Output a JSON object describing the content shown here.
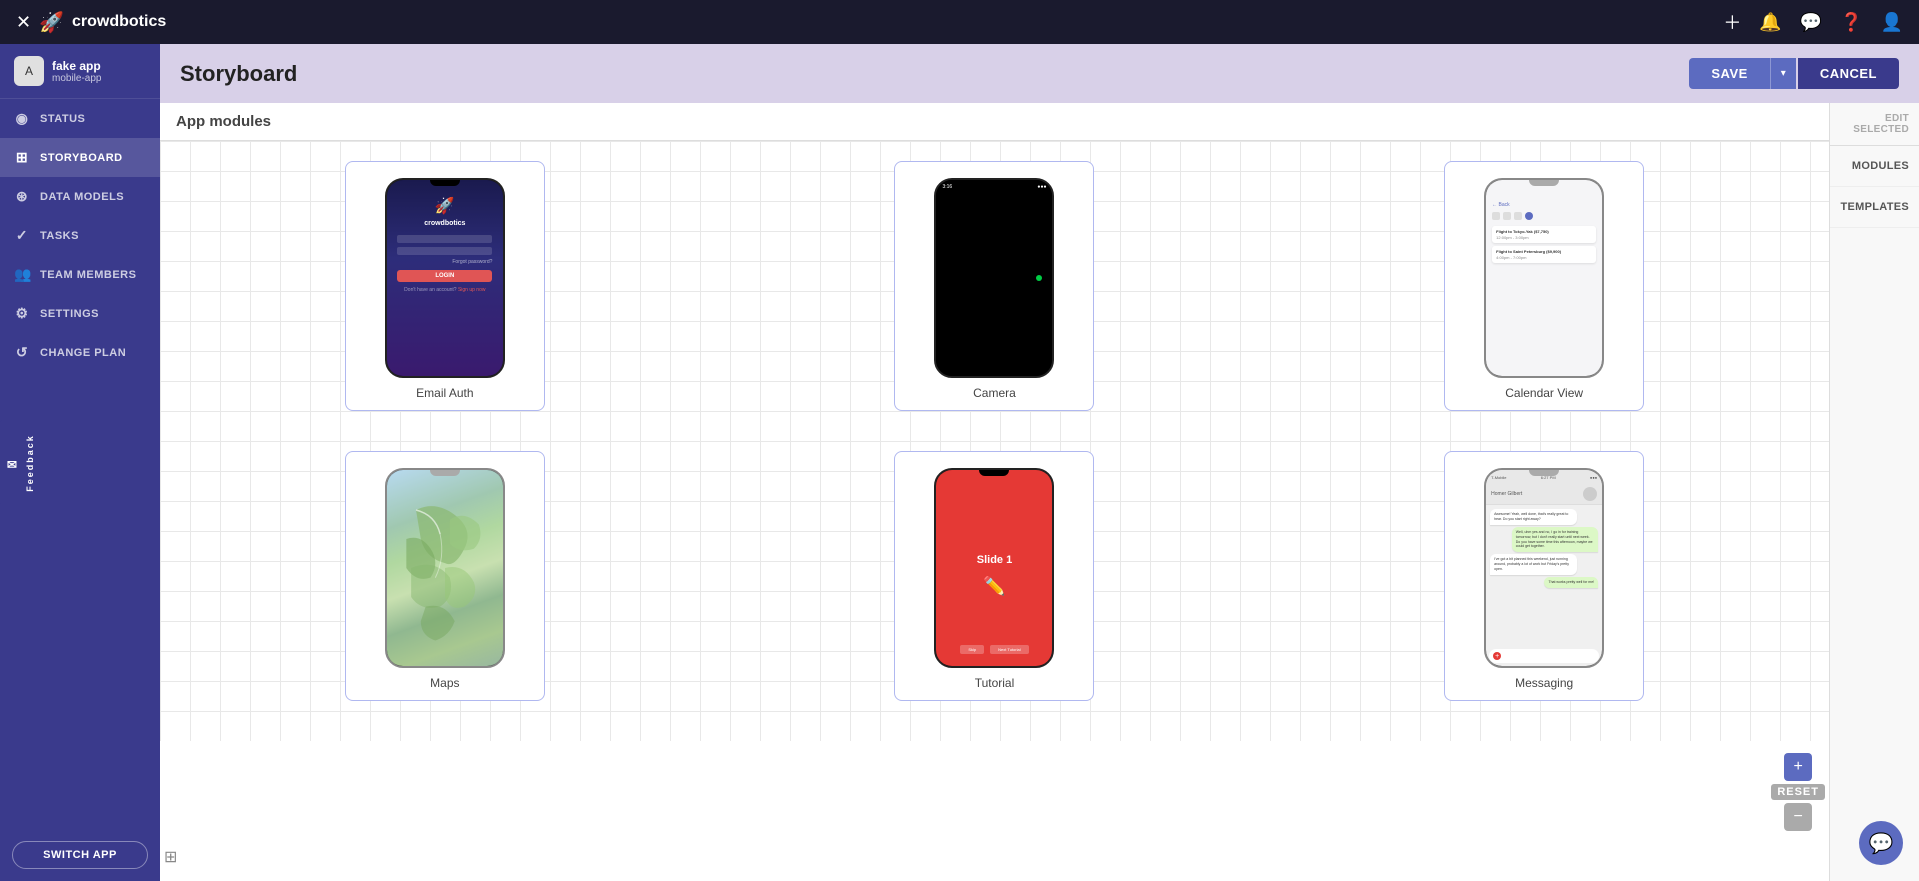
{
  "topnav": {
    "logo_text": "crowdbotics",
    "close_label": "✕"
  },
  "header": {
    "title": "Storyboard",
    "save_label": "SAVE",
    "cancel_label": "CANCEL"
  },
  "sidebar": {
    "app_name": "fake app",
    "app_sub": "mobile-app",
    "items": [
      {
        "id": "status",
        "label": "STATUS",
        "icon": "◉"
      },
      {
        "id": "storyboard",
        "label": "STORYBOARD",
        "icon": "⊞",
        "active": true
      },
      {
        "id": "data-models",
        "label": "DATA MODELS",
        "icon": "⊛"
      },
      {
        "id": "tasks",
        "label": "TASKS",
        "icon": "✓"
      },
      {
        "id": "team-members",
        "label": "TEAM MEMBERS",
        "icon": "👥"
      },
      {
        "id": "settings",
        "label": "SETTINGS",
        "icon": "⚙"
      },
      {
        "id": "change-plan",
        "label": "CHANGE PLAN",
        "icon": "↺"
      }
    ],
    "switch_app_label": "SWITCH APP",
    "feedback_label": "Feedback"
  },
  "canvas": {
    "section_label": "App modules",
    "modules": [
      {
        "id": "email-auth",
        "label": "Email Auth"
      },
      {
        "id": "camera",
        "label": "Camera"
      },
      {
        "id": "calendar-view",
        "label": "Calendar View"
      },
      {
        "id": "maps",
        "label": "Maps"
      },
      {
        "id": "tutorial",
        "label": "Tutorial"
      },
      {
        "id": "messaging",
        "label": "Messaging"
      }
    ]
  },
  "right_panel": {
    "edit_selected_label": "EDIT\nSELECTED",
    "tabs": [
      {
        "id": "modules",
        "label": "MODULES"
      },
      {
        "id": "templates",
        "label": "TEMPLATES"
      }
    ]
  },
  "controls": {
    "reset_label": "RESET",
    "zoom_in": "+",
    "zoom_out": "−"
  }
}
